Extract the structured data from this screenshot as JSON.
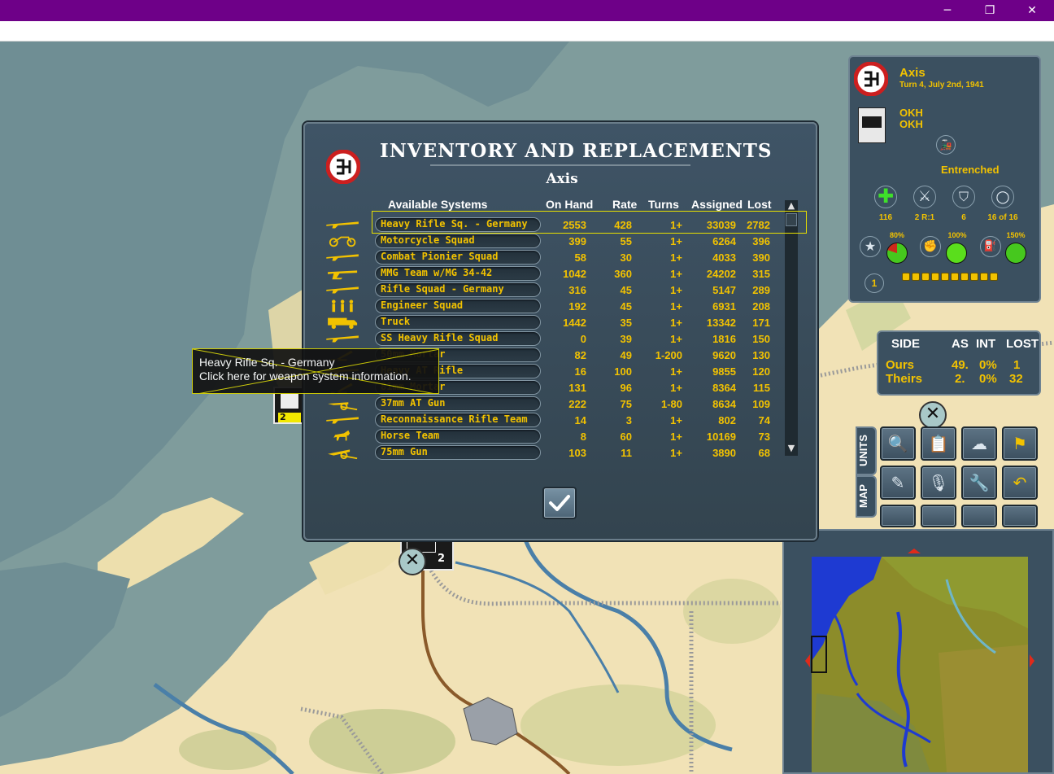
{
  "window": {
    "controls": {
      "minimize": "─",
      "maximize": "❐",
      "close": "✕"
    }
  },
  "dialog": {
    "title": "INVENTORY AND REPLACEMENTS",
    "side": "Axis",
    "columns": {
      "available": "Available Systems",
      "on_hand": "On Hand",
      "rate": "Rate",
      "turns": "Turns",
      "assigned": "Assigned",
      "lost": "Lost"
    },
    "rows": [
      {
        "icon": "rifle-icon",
        "name": "Heavy Rifle Sq. - Germany",
        "on_hand": "2553",
        "rate": "428",
        "turns": "1+",
        "assigned": "33039",
        "lost": "2782"
      },
      {
        "icon": "motorcycle-icon",
        "name": "Motorcycle Squad",
        "on_hand": "399",
        "rate": "55",
        "turns": "1+",
        "assigned": "6264",
        "lost": "396"
      },
      {
        "icon": "rifle-icon",
        "name": "Combat Pionier Squad",
        "on_hand": "58",
        "rate": "30",
        "turns": "1+",
        "assigned": "4033",
        "lost": "390"
      },
      {
        "icon": "machine-gun-icon",
        "name": "MMG Team w/MG 34-42",
        "on_hand": "1042",
        "rate": "360",
        "turns": "1+",
        "assigned": "24202",
        "lost": "315"
      },
      {
        "icon": "rifle-icon",
        "name": "Rifle Squad - Germany",
        "on_hand": "316",
        "rate": "45",
        "turns": "1+",
        "assigned": "5147",
        "lost": "289"
      },
      {
        "icon": "engineers-icon",
        "name": "Engineer Squad",
        "on_hand": "192",
        "rate": "45",
        "turns": "1+",
        "assigned": "6931",
        "lost": "208"
      },
      {
        "icon": "truck-icon",
        "name": "Truck",
        "on_hand": "1442",
        "rate": "35",
        "turns": "1+",
        "assigned": "13342",
        "lost": "171"
      },
      {
        "icon": "rifle-icon",
        "name": "SS Heavy Rifle Squad",
        "on_hand": "0",
        "rate": "39",
        "turns": "1+",
        "assigned": "1816",
        "lost": "150"
      },
      {
        "icon": "mortar-icon",
        "name": "50mm Mortar",
        "on_hand": "82",
        "rate": "49",
        "turns": "1-200",
        "assigned": "9620",
        "lost": "130"
      },
      {
        "icon": "at-rifle-icon",
        "name": "Heavy AT Rifle",
        "on_hand": "16",
        "rate": "100",
        "turns": "1+",
        "assigned": "9855",
        "lost": "120"
      },
      {
        "icon": "mortar-icon",
        "name": "81mm Mortar",
        "on_hand": "131",
        "rate": "96",
        "turns": "1+",
        "assigned": "8364",
        "lost": "115"
      },
      {
        "icon": "at-gun-icon",
        "name": "37mm AT Gun",
        "on_hand": "222",
        "rate": "75",
        "turns": "1-80",
        "assigned": "8634",
        "lost": "109"
      },
      {
        "icon": "rifle-icon",
        "name": "Reconnaissance Rifle Team",
        "on_hand": "14",
        "rate": "3",
        "turns": "1+",
        "assigned": "802",
        "lost": "74"
      },
      {
        "icon": "horse-icon",
        "name": "Horse Team",
        "on_hand": "8",
        "rate": "60",
        "turns": "1+",
        "assigned": "10169",
        "lost": "73"
      },
      {
        "icon": "field-gun-icon",
        "name": "75mm Gun",
        "on_hand": "103",
        "rate": "11",
        "turns": "1+",
        "assigned": "3890",
        "lost": "68"
      }
    ],
    "ok_icon": "checkmark-icon"
  },
  "tooltip": {
    "line1": "Heavy Rifle Sq. - Germany",
    "line2": "Click here for weapon system information."
  },
  "info_panel": {
    "side": "Axis",
    "turn": "Turn 4, July 2nd, 1941",
    "hq_line1": "OKH",
    "hq_line2": "OKH",
    "status": "Entrenched",
    "stats": [
      "116",
      "2 R:1",
      "6",
      "16 of 16"
    ],
    "pcts": [
      "80%",
      "100%",
      "150%"
    ],
    "experience_level": "1",
    "colors": {
      "text": "#f2c200",
      "panel": "#3b5060"
    }
  },
  "summary": {
    "headers": {
      "side": "SIDE",
      "as": "AS",
      "int": "INT",
      "lost": "LOST"
    },
    "ours": {
      "label": "Ours",
      "as": "49.",
      "int": "0%",
      "lost": "1"
    },
    "theirs": {
      "label": "Theirs",
      "as": "2.",
      "int": "0%",
      "lost": "32"
    }
  },
  "toolbar": {
    "tabs": {
      "units": "UNITS",
      "map": "MAP"
    },
    "buttons": [
      "magnifier-icon",
      "clipboard-icon",
      "weather-icon",
      "flag-icon",
      "clipboard-tools-icon",
      "microphone-icon",
      "clipboard-wrench-icon",
      "undo-icon"
    ]
  },
  "map_counters": {
    "unit_a_strength": "2",
    "unit_b_strength": "2"
  }
}
